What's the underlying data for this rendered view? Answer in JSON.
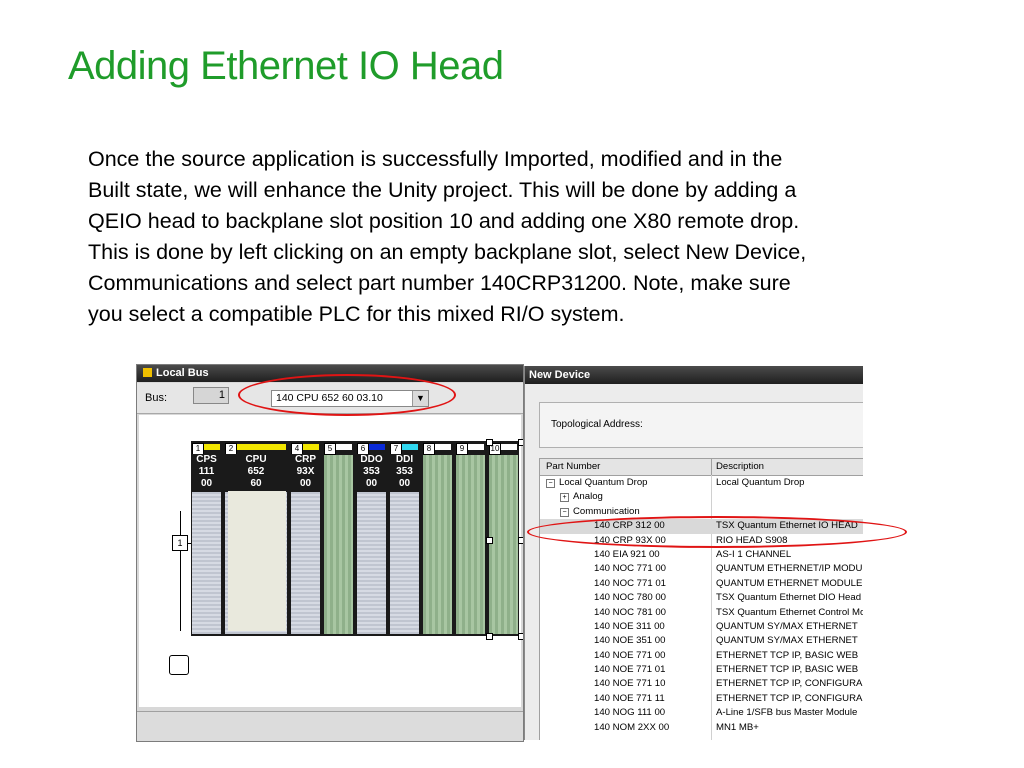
{
  "slide": {
    "title": "Adding Ethernet IO Head",
    "body_lines": [
      "Once the source application is successfully Imported, modified and in the",
      "Built state, we will enhance the Unity project. This will be done by adding a",
      "QEIO head to backplane slot position 10 and adding one X80 remote drop.",
      "This is done by left clicking on an empty backplane  slot, select New Device,",
      "Communications and select part number 140CRP31200.  Note, make sure",
      "you select a compatible PLC for this mixed RI/O system."
    ]
  },
  "local_bus": {
    "title": "Local Bus",
    "bus_label": "Bus:",
    "bus_number": "1",
    "cpu_select": "140 CPU 652 60   03.10",
    "bus_node_label": "1",
    "modules": [
      {
        "slot": "1",
        "name": [
          "CPS",
          "111",
          "00"
        ],
        "bar_color": "#f2e600"
      },
      {
        "slot": "2",
        "name": [
          "CPU",
          "652",
          "60"
        ],
        "bar_color": "#f2e600"
      },
      {
        "slot": "4",
        "name": [
          "CRP",
          "93X",
          "00"
        ],
        "bar_color": "#f2e600"
      },
      {
        "slot": "5",
        "name": [
          "",
          "",
          ""
        ],
        "bar_color": "#ffffff"
      },
      {
        "slot": "6",
        "name": [
          "DDO",
          "353",
          "00"
        ],
        "bar_color": "#0a2ad8"
      },
      {
        "slot": "7",
        "name": [
          "DDI",
          "353",
          "00"
        ],
        "bar_color": "#30d8f0"
      },
      {
        "slot": "8",
        "name": [
          "",
          "",
          ""
        ],
        "bar_color": "#ffffff"
      },
      {
        "slot": "9",
        "name": [
          "",
          "",
          ""
        ],
        "bar_color": "#ffffff"
      },
      {
        "slot": "10",
        "name": [
          "",
          "",
          ""
        ],
        "bar_color": "#ffffff"
      }
    ]
  },
  "new_device": {
    "title": "New Device",
    "topological_label": "Topological Address:",
    "col_part": "Part Number",
    "col_desc": "Description",
    "tree": [
      {
        "pn": "Local Quantum Drop",
        "desc": "Local Quantum Drop",
        "level": 0,
        "box": "−"
      },
      {
        "pn": "Analog",
        "desc": "",
        "level": 1,
        "box": "+"
      },
      {
        "pn": "Communication",
        "desc": "",
        "level": 1,
        "box": "−"
      },
      {
        "pn": "140 CRP 312 00",
        "desc": "TSX Quantum Ethernet IO HEAD",
        "level": 2,
        "selected": true
      },
      {
        "pn": "140 CRP 93X 00",
        "desc": "RIO HEAD S908",
        "level": 2
      },
      {
        "pn": "140 EIA 921 00",
        "desc": "AS-I 1 CHANNEL",
        "level": 2
      },
      {
        "pn": "140 NOC 771 00",
        "desc": "QUANTUM ETHERNET/IP MODU",
        "level": 2
      },
      {
        "pn": "140 NOC 771 01",
        "desc": "QUANTUM ETHERNET MODULE",
        "level": 2
      },
      {
        "pn": "140 NOC 780 00",
        "desc": "TSX Quantum Ethernet DIO Head",
        "level": 2
      },
      {
        "pn": "140 NOC 781 00",
        "desc": "TSX Quantum Ethernet Control Mo",
        "level": 2
      },
      {
        "pn": "140 NOE 311 00",
        "desc": "QUANTUM SY/MAX ETHERNET",
        "level": 2
      },
      {
        "pn": "140 NOE 351 00",
        "desc": "QUANTUM SY/MAX ETHERNET",
        "level": 2
      },
      {
        "pn": "140 NOE 771 00",
        "desc": "ETHERNET TCP IP, BASIC WEB",
        "level": 2
      },
      {
        "pn": "140 NOE 771 01",
        "desc": "ETHERNET TCP IP, BASIC WEB",
        "level": 2
      },
      {
        "pn": "140 NOE 771 10",
        "desc": "ETHERNET TCP IP, CONFIGURA",
        "level": 2
      },
      {
        "pn": "140 NOE 771 11",
        "desc": "ETHERNET TCP IP, CONFIGURA",
        "level": 2
      },
      {
        "pn": "140 NOG 111 00",
        "desc": "A-Line 1/SFB bus Master Module",
        "level": 2
      },
      {
        "pn": "140 NOM 2XX 00",
        "desc": "MN1 MB+",
        "level": 2
      }
    ]
  },
  "colors": {
    "title_green": "#1f9c2a",
    "highlight_red": "#e01414"
  }
}
